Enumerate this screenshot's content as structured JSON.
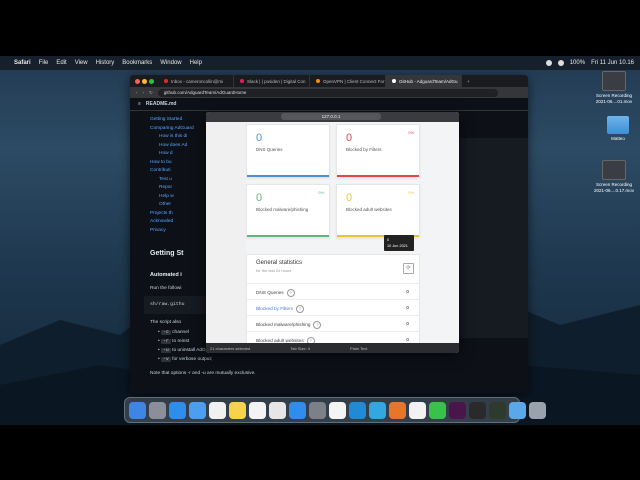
{
  "menubar": {
    "apple_icon": "apple-icon",
    "items": [
      "Safari",
      "File",
      "Edit",
      "View",
      "History",
      "Bookmarks",
      "Window",
      "Help"
    ],
    "battery": "100%",
    "clock": "Fri 11 Jun  10.16"
  },
  "desktop_icons": [
    {
      "label": "Screen Recording 2021-06....01.mov",
      "type": "shot"
    },
    {
      "label": "Matteo",
      "type": "folder"
    },
    {
      "label": "Screen Recording 2021-06....0.17.mov",
      "type": "shot"
    }
  ],
  "browser": {
    "tabs": [
      {
        "label": "Inbox - cameroncollin@mi",
        "color": "#d93025"
      },
      {
        "label": "Slack | | posiden | Digital Con",
        "color": "#e01e5a"
      },
      {
        "label": "OpenVPN | Client Connect For",
        "color": "#f29100"
      },
      {
        "label": "GitHub - AdguardTeam/AdGu",
        "color": "#ffffff",
        "active": true
      }
    ],
    "url": "github.com/AdguardTeam/AdGuardHome",
    "readme_title": "README.md",
    "toc": [
      {
        "text": "Getting Started",
        "level": 1
      },
      {
        "text": "Comparing AdGuard",
        "level": 1
      },
      {
        "text": "How is this di",
        "level": 2
      },
      {
        "text": "How does Ad",
        "level": 2
      },
      {
        "text": "How d",
        "level": 2
      },
      {
        "text": "How to bu",
        "level": 1
      },
      {
        "text": "Contributi",
        "level": 1
      },
      {
        "text": "Test u",
        "level": 2
      },
      {
        "text": "Repor",
        "level": 2
      },
      {
        "text": "Help w",
        "level": 2
      },
      {
        "text": "Other",
        "level": 2
      },
      {
        "text": "Projects th",
        "level": 1
      },
      {
        "text": "Acknowled",
        "level": 1
      },
      {
        "text": "Privacy",
        "level": 1
      }
    ],
    "heading": "Getting St",
    "subheading": "Automated i",
    "run_text": "Run the followi",
    "code": "sh/raw.githu",
    "script_text": "The script also",
    "options": [
      {
        "flag": "-c",
        "text": "channel"
      },
      {
        "flag": "-r",
        "text": "to reinst"
      },
      {
        "flag": "-u",
        "text": "to uninstall AdGuard Home;"
      },
      {
        "flag": "-v",
        "text": "for verbose output;"
      }
    ],
    "note": "Note that options -r and -u are mutually exclusive."
  },
  "overlay": {
    "url": "127.0.0.1",
    "status": [
      "21 characters selected",
      "Tab Size: 4",
      "Plain Text"
    ],
    "cards": [
      {
        "num": "0",
        "label": "DNS Queries",
        "pct": "",
        "color": "#4a90d9"
      },
      {
        "num": "0",
        "label": "Blocked by Filters",
        "pct": "0%",
        "color": "#e64545"
      },
      {
        "num": "0",
        "label": "Blocked malware/phishing",
        "pct": "0%",
        "color": "#67b279"
      },
      {
        "num": "0",
        "label": "Blocked adult websites",
        "pct": "0%",
        "color": "#e8c43a"
      }
    ],
    "tooltip": {
      "line1": "0",
      "line2": "10 Jun 2021"
    },
    "stats_title": "General statistics",
    "stats_sub": "for the last 24 hours",
    "rows": [
      {
        "name": "DNS Queries",
        "value": "0",
        "link": false
      },
      {
        "name": "Blocked by Filters",
        "value": "0",
        "link": true
      },
      {
        "name": "Blocked malware/phishing",
        "value": "0",
        "link": false
      },
      {
        "name": "Blocked adult websites",
        "value": "0",
        "link": false
      }
    ]
  },
  "dock": [
    {
      "name": "finder-icon",
      "color": "#3d86e6"
    },
    {
      "name": "launchpad-icon",
      "color": "#8a8f99"
    },
    {
      "name": "safari-icon",
      "color": "#2f8ded"
    },
    {
      "name": "mail-icon",
      "color": "#4a9ff0"
    },
    {
      "name": "calendar-icon",
      "color": "#f1f1f1"
    },
    {
      "name": "notes-icon",
      "color": "#f6d34a"
    },
    {
      "name": "reminders-icon",
      "color": "#f4f4f4"
    },
    {
      "name": "photos-icon",
      "color": "#e6e6e6"
    },
    {
      "name": "app-store-icon",
      "color": "#2f8ded"
    },
    {
      "name": "system-prefs-icon",
      "color": "#7c8088"
    },
    {
      "name": "clock-icon",
      "color": "#f4f4f4"
    },
    {
      "name": "edge-icon",
      "color": "#1f8bd6"
    },
    {
      "name": "telegram-icon",
      "color": "#33a7e0"
    },
    {
      "name": "firefox-icon",
      "color": "#e7762b"
    },
    {
      "name": "chrome-icon",
      "color": "#f2f2f2"
    },
    {
      "name": "messages-icon",
      "color": "#38c24a"
    },
    {
      "name": "slack-icon",
      "color": "#4a154b"
    },
    {
      "name": "terminal-icon",
      "color": "#2a2a2a"
    },
    {
      "name": "activity-monitor-icon",
      "color": "#2f3a2e"
    },
    {
      "name": "folder-icon",
      "color": "#5aa7ea"
    },
    {
      "name": "trash-icon",
      "color": "#9aa3ad"
    }
  ]
}
